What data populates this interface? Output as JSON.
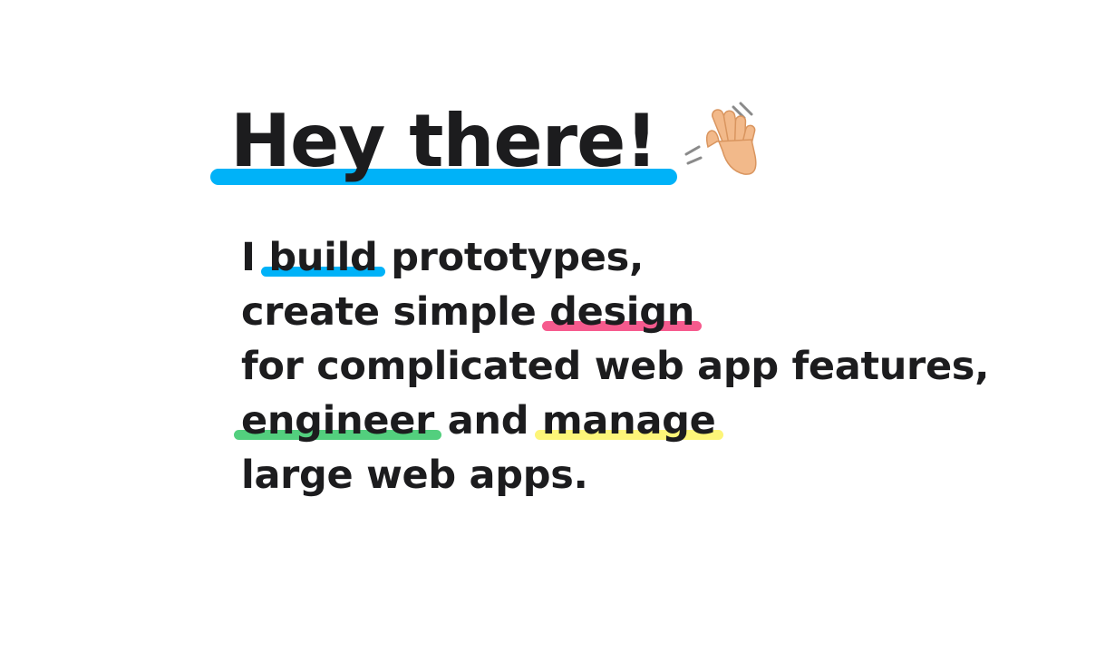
{
  "colors": {
    "text": "#1c1c1e",
    "blue": "#00b2f8",
    "pink": "#f65a8d",
    "green": "#53cf7e",
    "yellow": "#fdf579"
  },
  "hero": {
    "headline": "Hey there!",
    "headline_underline_color": "#00b2f8",
    "wave_icon": "waving-hand-icon"
  },
  "intro": {
    "line1": {
      "pre": "I ",
      "highlight": "build",
      "post": " prototypes,",
      "color": "#00b2f8"
    },
    "line2": {
      "pre": "create simple ",
      "highlight": "design",
      "post": "",
      "color": "#f65a8d"
    },
    "line3": {
      "text": "for complicated web app features,"
    },
    "line4": {
      "highlight1": "engineer",
      "color1": "#53cf7e",
      "mid": " and ",
      "highlight2": "manage",
      "color2": "#fdf579"
    },
    "line5": {
      "text": "large web apps."
    }
  }
}
